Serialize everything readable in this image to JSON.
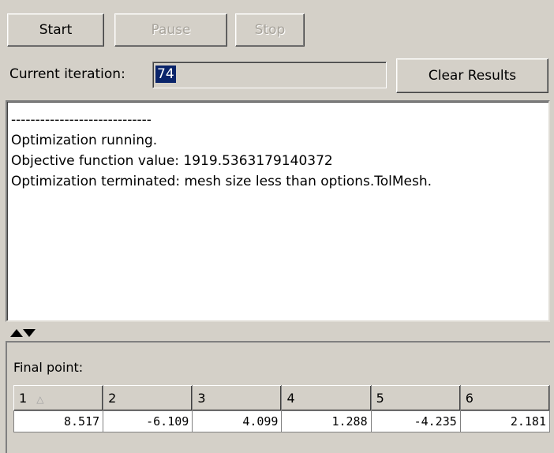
{
  "toolbar": {
    "start_label": "Start",
    "pause_label": "Pause",
    "stop_label": "Stop",
    "clear_label": "Clear Results"
  },
  "iteration": {
    "label": "Current iteration:",
    "value": "74"
  },
  "output": {
    "lines": [
      "-----------------------------",
      "Optimization running.",
      "Objective function value: 1919.5363179140372",
      "Optimization terminated: mesh size less than options.TolMesh."
    ]
  },
  "final_point": {
    "label": "Final point:",
    "columns": [
      "1",
      "2",
      "3",
      "4",
      "5",
      "6"
    ],
    "sort_icon": "△",
    "values": [
      "8.517",
      "-6.109",
      "4.099",
      "1.288",
      "-4.235",
      "2.181"
    ]
  }
}
